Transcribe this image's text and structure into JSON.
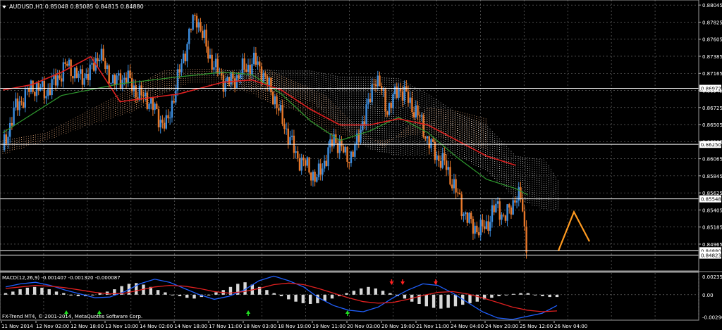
{
  "window": {
    "symbol_line": "AUDUSD,H1  0.85048 0.85085 0.84815 0.84880",
    "copyright": "FX-Trend MT4, © 2001-2014, MetaQuotes Software Corp."
  },
  "colors": {
    "background": "#000000",
    "grid": "#7a7a7a",
    "bull": "#3c8ee0",
    "bear": "#e8782a",
    "ma_fast": "#2f9a2f",
    "ma_slow": "#e02020",
    "ma_long": "#c02020",
    "cloud_a": "#f0b080",
    "cloud_b": "#d0d0d0",
    "level_line": "#ffffff",
    "projection": "#ff9a20",
    "macd_hist": "#d8d8d8",
    "macd_line": "#2060ff",
    "macd_signal": "#e02020",
    "arrow_up": "#20e020",
    "arrow_down": "#ff2020"
  },
  "chart_data": [
    {
      "type": "candlestick",
      "title": "AUDUSD,H1  0.85048 0.85085 0.84815 0.84880",
      "ylim": [
        0.8462,
        0.8811
      ],
      "price_ticks": [
        "0.88045",
        "0.87825",
        "0.87605",
        "0.87385",
        "0.87165",
        "0.86945",
        "0.86725",
        "0.86505",
        "0.86285",
        "0.86065",
        "0.85845",
        "0.85625",
        "0.85405",
        "0.85185",
        "0.84965"
      ],
      "time_labels": [
        "11 Nov 2014",
        "12 Nov 02:00",
        "12 Nov 18:00",
        "13 Nov 10:00",
        "14 Nov 02:00",
        "14 Nov 18:00",
        "17 Nov 11:00",
        "18 Nov 03:00",
        "18 Nov 19:00",
        "19 Nov 11:00",
        "20 Nov 03:00",
        "20 Nov 19:00",
        "21 Nov 11:00",
        "24 Nov 04:00",
        "24 Nov 20:00",
        "25 Nov 12:00",
        "26 Nov 04:00"
      ],
      "levels": [
        {
          "value": 0.86972,
          "label": "0.86972"
        },
        {
          "value": 0.8625,
          "label": "0.86250"
        },
        {
          "value": 0.85548,
          "label": "0.85548"
        },
        {
          "value": 0.8488,
          "label": "0.84880"
        },
        {
          "value": 0.84823,
          "label": "0.84823"
        }
      ],
      "price_path": [
        [
          0,
          0.8618
        ],
        [
          8,
          0.867
        ],
        [
          20,
          0.87
        ],
        [
          30,
          0.8692
        ],
        [
          44,
          0.8728
        ],
        [
          52,
          0.871
        ],
        [
          60,
          0.8718
        ],
        [
          66,
          0.8744
        ],
        [
          70,
          0.8722
        ],
        [
          76,
          0.8705
        ],
        [
          84,
          0.8712
        ],
        [
          92,
          0.869
        ],
        [
          100,
          0.8682
        ],
        [
          106,
          0.866
        ],
        [
          112,
          0.8648
        ],
        [
          118,
          0.87
        ],
        [
          124,
          0.8742
        ],
        [
          128,
          0.8775
        ],
        [
          132,
          0.879
        ],
        [
          136,
          0.8768
        ],
        [
          140,
          0.8742
        ],
        [
          146,
          0.872
        ],
        [
          150,
          0.8708
        ],
        [
          154,
          0.8705
        ],
        [
          160,
          0.8712
        ],
        [
          164,
          0.8722
        ],
        [
          168,
          0.8725
        ],
        [
          172,
          0.8732
        ],
        [
          176,
          0.8722
        ],
        [
          180,
          0.8705
        ],
        [
          186,
          0.8682
        ],
        [
          190,
          0.8658
        ],
        [
          196,
          0.8632
        ],
        [
          200,
          0.861
        ],
        [
          206,
          0.86
        ],
        [
          210,
          0.859
        ],
        [
          214,
          0.858
        ],
        [
          218,
          0.8596
        ],
        [
          222,
          0.8616
        ],
        [
          226,
          0.8632
        ],
        [
          230,
          0.8625
        ],
        [
          234,
          0.8608
        ],
        [
          238,
          0.8612
        ],
        [
          242,
          0.8628
        ],
        [
          246,
          0.866
        ],
        [
          250,
          0.8678
        ],
        [
          254,
          0.8715
        ],
        [
          258,
          0.8695
        ],
        [
          262,
          0.867
        ],
        [
          266,
          0.8682
        ],
        [
          270,
          0.8698
        ],
        [
          274,
          0.869
        ],
        [
          278,
          0.8678
        ],
        [
          284,
          0.866
        ],
        [
          290,
          0.863
        ],
        [
          296,
          0.861
        ],
        [
          302,
          0.8598
        ],
        [
          308,
          0.857
        ],
        [
          314,
          0.854
        ],
        [
          320,
          0.852
        ],
        [
          326,
          0.8515
        ],
        [
          330,
          0.852
        ],
        [
          334,
          0.8538
        ],
        [
          338,
          0.8545
        ],
        [
          342,
          0.853
        ],
        [
          346,
          0.854
        ],
        [
          350,
          0.856
        ],
        [
          354,
          0.8552
        ],
        [
          356,
          0.8512
        ],
        [
          358,
          0.849
        ]
      ],
      "ma_fast": [
        [
          0,
          0.864
        ],
        [
          40,
          0.8688
        ],
        [
          80,
          0.8703
        ],
        [
          120,
          0.8712
        ],
        [
          150,
          0.8718
        ],
        [
          170,
          0.8715
        ],
        [
          190,
          0.869
        ],
        [
          210,
          0.8655
        ],
        [
          230,
          0.863
        ],
        [
          250,
          0.8642
        ],
        [
          270,
          0.866
        ],
        [
          290,
          0.864
        ],
        [
          310,
          0.8608
        ],
        [
          330,
          0.858
        ],
        [
          350,
          0.8568
        ],
        [
          358,
          0.856
        ]
      ],
      "ma_slow": [
        [
          0,
          0.8695
        ],
        [
          20,
          0.8702
        ],
        [
          40,
          0.8718
        ],
        [
          60,
          0.8738
        ],
        [
          80,
          0.868
        ],
        [
          120,
          0.869
        ],
        [
          150,
          0.8705
        ],
        [
          170,
          0.8708
        ],
        [
          190,
          0.8695
        ],
        [
          210,
          0.867
        ],
        [
          230,
          0.865
        ],
        [
          250,
          0.865
        ],
        [
          270,
          0.8658
        ],
        [
          290,
          0.865
        ],
        [
          310,
          0.863
        ],
        [
          330,
          0.861
        ],
        [
          350,
          0.8598
        ]
      ],
      "cloud_a_top": [
        [
          0,
          0.863
        ],
        [
          30,
          0.864
        ],
        [
          60,
          0.867
        ],
        [
          90,
          0.87
        ],
        [
          110,
          0.872
        ],
        [
          130,
          0.8722
        ],
        [
          150,
          0.8722
        ],
        [
          170,
          0.8712
        ],
        [
          180,
          0.8722
        ],
        [
          200,
          0.8705
        ],
        [
          220,
          0.8688
        ],
        [
          240,
          0.865
        ],
        [
          260,
          0.862
        ],
        [
          290,
          0.8672
        ],
        [
          310,
          0.8668
        ],
        [
          330,
          0.8658
        ]
      ],
      "cloud_a_bottom": [
        [
          0,
          0.8612
        ],
        [
          30,
          0.863
        ],
        [
          60,
          0.865
        ],
        [
          90,
          0.8668
        ],
        [
          110,
          0.869
        ],
        [
          130,
          0.8705
        ],
        [
          150,
          0.87
        ],
        [
          170,
          0.869
        ],
        [
          180,
          0.868
        ],
        [
          200,
          0.8668
        ],
        [
          220,
          0.864
        ],
        [
          240,
          0.8632
        ],
        [
          260,
          0.863
        ],
        [
          290,
          0.864
        ],
        [
          310,
          0.8625
        ],
        [
          330,
          0.8618
        ]
      ],
      "cloud_b_top": [
        [
          150,
          0.872
        ],
        [
          170,
          0.8722
        ],
        [
          190,
          0.872
        ],
        [
          210,
          0.872
        ],
        [
          230,
          0.8712
        ],
        [
          250,
          0.8712
        ],
        [
          270,
          0.871
        ],
        [
          290,
          0.869
        ],
        [
          310,
          0.8665
        ],
        [
          330,
          0.865
        ],
        [
          350,
          0.861
        ],
        [
          370,
          0.8605
        ],
        [
          380,
          0.8575
        ]
      ],
      "cloud_b_bottom": [
        [
          150,
          0.87
        ],
        [
          170,
          0.8698
        ],
        [
          190,
          0.869
        ],
        [
          210,
          0.868
        ],
        [
          230,
          0.865
        ],
        [
          250,
          0.8618
        ],
        [
          270,
          0.861
        ],
        [
          290,
          0.861
        ],
        [
          310,
          0.861
        ],
        [
          330,
          0.859
        ],
        [
          350,
          0.8555
        ],
        [
          370,
          0.854
        ],
        [
          380,
          0.854
        ]
      ],
      "projection": [
        [
          0,
          0.8488
        ],
        [
          1,
          0.8538
        ],
        [
          2,
          0.85
        ]
      ]
    },
    {
      "type": "macd",
      "label": "MACD(12,26,9) -0.001407 -0.001320 -0.000087",
      "ylim": [
        -0.0032,
        0.0028
      ],
      "y_ticks": [
        "0.00235",
        "0.00",
        "-0.00290"
      ],
      "histogram": [
        0.0002,
        0.0004,
        0.0007,
        0.0009,
        0.001,
        0.0009,
        0.0007,
        0.0004,
        0.0002,
        -0.0001,
        -0.0002,
        -0.0002,
        0.0,
        0.0002,
        0.0004,
        0.0007,
        0.0011,
        0.0014,
        0.0015,
        0.0013,
        0.001,
        0.0006,
        0.0003,
        0.0,
        -0.0002,
        -0.0004,
        -0.0005,
        -0.0003,
        0.0,
        0.0003,
        0.0006,
        0.001,
        0.0014,
        0.0016,
        0.0013,
        0.001,
        0.0006,
        0.0002,
        -0.0002,
        -0.0006,
        -0.0009,
        -0.0011,
        -0.0012,
        -0.0011,
        -0.0008,
        -0.0005,
        -0.0002,
        0.0002,
        0.0005,
        0.0008,
        0.001,
        0.0008,
        0.0005,
        0.0002,
        -0.0002,
        -0.0005,
        -0.0009,
        -0.0012,
        -0.0015,
        -0.0017,
        -0.0018,
        -0.0017,
        -0.0015,
        -0.0013,
        -0.0011,
        -0.0009,
        -0.0006,
        -0.0004,
        -0.0002,
        0.0,
        0.0001,
        0.0002,
        0.0002,
        0.0,
        -0.0002,
        -0.0003,
        -0.0003
      ],
      "macd_line": [
        0.001,
        0.0014,
        0.0016,
        0.0012,
        0.0006,
        0.0001,
        -0.0004,
        -0.0003,
        0.0004,
        0.0014,
        0.002,
        0.0016,
        0.0008,
        0.0,
        -0.0006,
        -0.0002,
        0.0006,
        0.0018,
        0.0024,
        0.0018,
        0.001,
        -0.0004,
        -0.0014,
        -0.002,
        -0.0022,
        -0.0016,
        -0.0004,
        0.0006,
        0.0014,
        0.0012,
        0.0002,
        -0.001,
        -0.0022,
        -0.003,
        -0.0032,
        -0.0028,
        -0.0024,
        -0.0014
      ],
      "signal_line": [
        0.0008,
        0.001,
        0.0012,
        0.0011,
        0.0009,
        0.0006,
        0.0003,
        0.0001,
        0.0002,
        0.0006,
        0.001,
        0.0012,
        0.0011,
        0.0008,
        0.0004,
        0.0002,
        0.0004,
        0.0008,
        0.0013,
        0.0015,
        0.0013,
        0.0008,
        0.0002,
        -0.0004,
        -0.0009,
        -0.0011,
        -0.001,
        -0.0006,
        -0.0001,
        0.0003,
        0.0004,
        0.0001,
        -0.0004,
        -0.001,
        -0.0016,
        -0.002,
        -0.0022,
        -0.0021
      ],
      "arrows": [
        {
          "dir": "up",
          "pos": 0.11
        },
        {
          "dir": "up",
          "pos": 0.17
        },
        {
          "dir": "up",
          "pos": 0.44
        },
        {
          "dir": "up",
          "pos": 0.62
        },
        {
          "dir": "down",
          "pos": 0.7
        },
        {
          "dir": "down",
          "pos": 0.72
        },
        {
          "dir": "down",
          "pos": 0.78
        }
      ]
    }
  ]
}
